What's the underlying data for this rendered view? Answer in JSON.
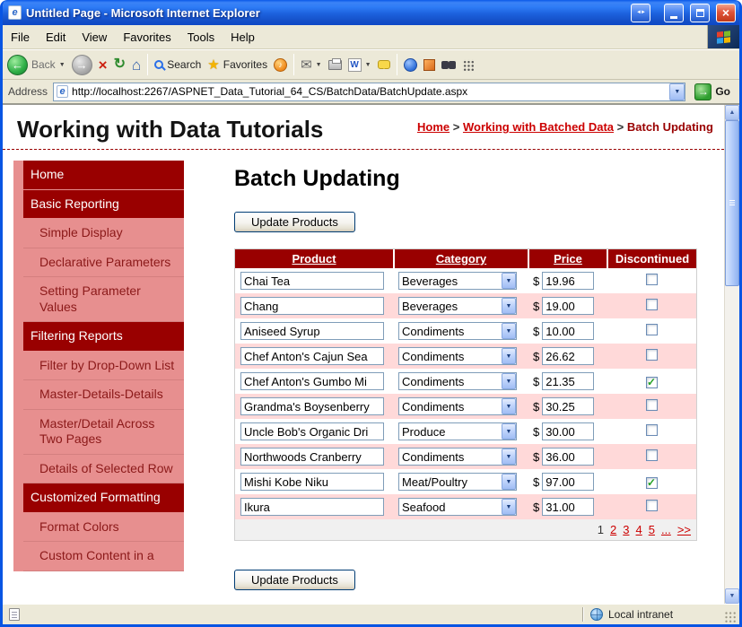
{
  "window": {
    "title": "Untitled Page - Microsoft Internet Explorer"
  },
  "menu": {
    "items": [
      "File",
      "Edit",
      "View",
      "Favorites",
      "Tools",
      "Help"
    ]
  },
  "toolbar": {
    "back_label": "Back",
    "search_label": "Search",
    "favorites_label": "Favorites"
  },
  "address": {
    "label": "Address",
    "value": "http://localhost:2267/ASPNET_Data_Tutorial_64_CS/BatchData/BatchUpdate.aspx",
    "go_label": "Go"
  },
  "page": {
    "site_title": "Working with Data Tutorials",
    "breadcrumb": {
      "separator": ">",
      "crumbs": [
        {
          "label": "Home"
        },
        {
          "label": "Working with Batched Data"
        },
        {
          "label": "Batch Updating"
        }
      ]
    },
    "heading": "Batch Updating",
    "update_button_label": "Update Products",
    "sidebar": {
      "items": [
        {
          "label": "Home",
          "level": 0
        },
        {
          "label": "Basic Reporting",
          "level": 0
        },
        {
          "label": "Simple Display",
          "level": 1
        },
        {
          "label": "Declarative Parameters",
          "level": 1
        },
        {
          "label": "Setting Parameter Values",
          "level": 1
        },
        {
          "label": "Filtering Reports",
          "level": 0
        },
        {
          "label": "Filter by Drop-Down List",
          "level": 1
        },
        {
          "label": "Master-Details-Details",
          "level": 1
        },
        {
          "label": "Master/Detail Across Two Pages",
          "level": 1
        },
        {
          "label": "Details of Selected Row",
          "level": 1
        },
        {
          "label": "Customized Formatting",
          "level": 0
        },
        {
          "label": "Format Colors",
          "level": 1
        },
        {
          "label": "Custom Content in a",
          "level": 1
        }
      ]
    },
    "table": {
      "headers": [
        "Product",
        "Category",
        "Price",
        "Discontinued"
      ],
      "currency": "$",
      "rows": [
        {
          "product": "Chai Tea",
          "category": "Beverages",
          "price": "19.96",
          "discontinued": false
        },
        {
          "product": "Chang",
          "category": "Beverages",
          "price": "19.00",
          "discontinued": false
        },
        {
          "product": "Aniseed Syrup",
          "category": "Condiments",
          "price": "10.00",
          "discontinued": false
        },
        {
          "product": "Chef Anton's Cajun Sea",
          "category": "Condiments",
          "price": "26.62",
          "discontinued": false
        },
        {
          "product": "Chef Anton's Gumbo Mi",
          "category": "Condiments",
          "price": "21.35",
          "discontinued": true
        },
        {
          "product": "Grandma's Boysenberry",
          "category": "Condiments",
          "price": "30.25",
          "discontinued": false
        },
        {
          "product": "Uncle Bob's Organic Dri",
          "category": "Produce",
          "price": "30.00",
          "discontinued": false
        },
        {
          "product": "Northwoods Cranberry",
          "category": "Condiments",
          "price": "36.00",
          "discontinued": false
        },
        {
          "product": "Mishi Kobe Niku",
          "category": "Meat/Poultry",
          "price": "97.00",
          "discontinued": true
        },
        {
          "product": "Ikura",
          "category": "Seafood",
          "price": "31.00",
          "discontinued": false
        }
      ],
      "pager": {
        "current": "1",
        "pages": [
          "2",
          "3",
          "4",
          "5",
          "..."
        ],
        "next_label": ">>"
      }
    }
  },
  "status_bar": {
    "zone": "Local intranet"
  },
  "icons": {
    "back": "←",
    "forward": "→",
    "stop": "×",
    "refresh": "↻",
    "home": "⌂",
    "star": "★",
    "note": "♪",
    "mail": "✉",
    "edit_w": "W",
    "dropdown": "▼",
    "up": "▲",
    "down": "▼",
    "go": "→",
    "check": "✓",
    "close": "×",
    "window_extra": "◄►"
  },
  "colors": {
    "maroon": "#990000",
    "sidebar_pink": "#e78f8f",
    "row_alt_pink": "#ffd9d9",
    "link_red": "#cc0000",
    "xp_title_blue": "#1c61dd"
  }
}
